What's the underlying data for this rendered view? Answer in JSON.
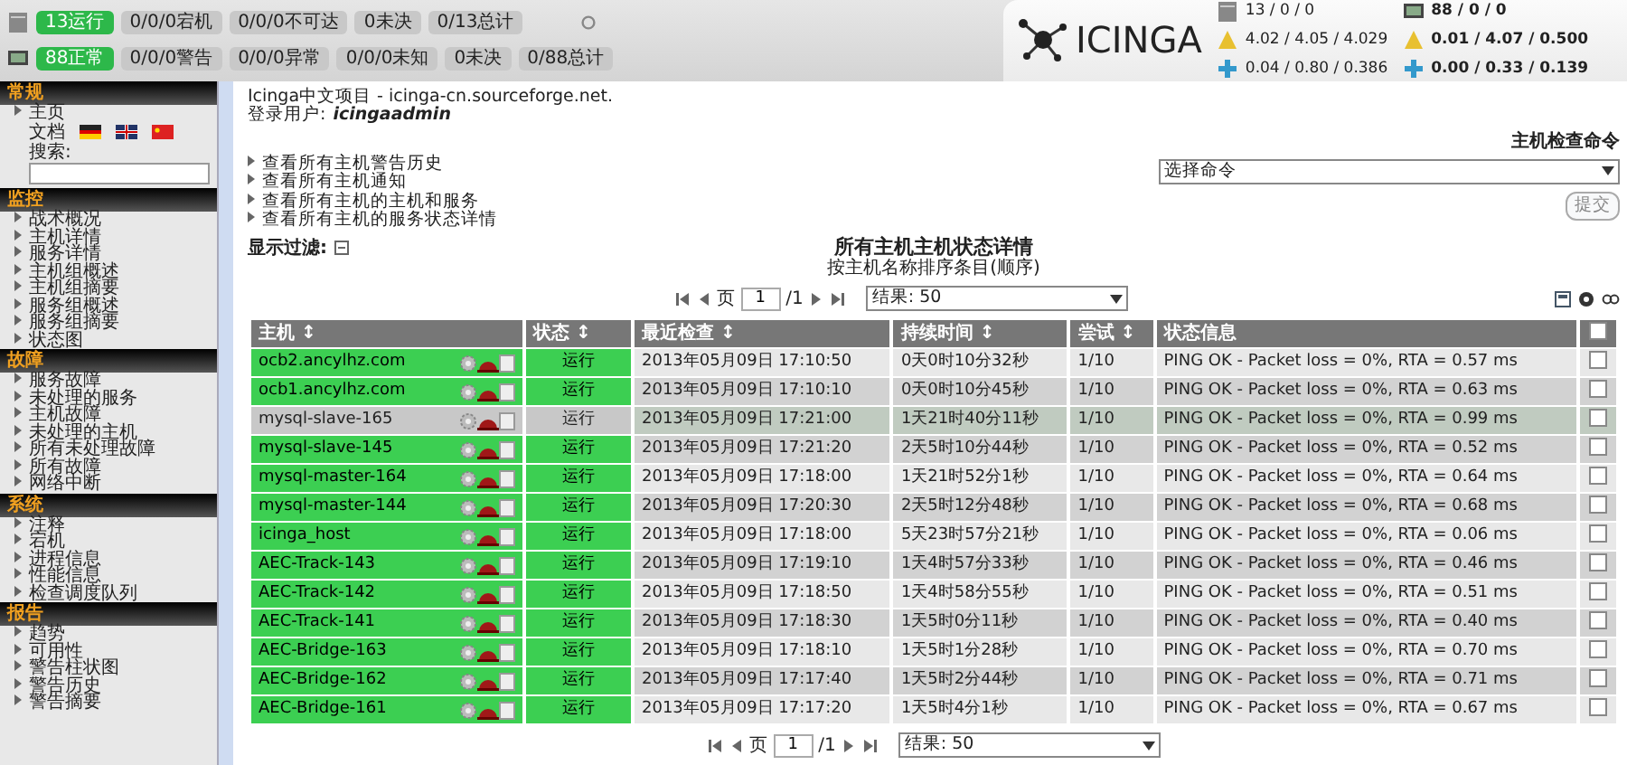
{
  "host_summary": {
    "items": [
      {
        "text": "13运行",
        "kind": "ok"
      },
      {
        "text": "0/0/0宕机",
        "kind": "plain"
      },
      {
        "text": "0/0/0不可达",
        "kind": "plain"
      },
      {
        "text": "0未决",
        "kind": "plain"
      },
      {
        "text": "0/13总计",
        "kind": "plain"
      }
    ]
  },
  "service_summary": {
    "items": [
      {
        "text": "88正常",
        "kind": "ok"
      },
      {
        "text": "0/0/0警告",
        "kind": "plain"
      },
      {
        "text": "0/0/0异常",
        "kind": "plain"
      },
      {
        "text": "0/0/0未知",
        "kind": "plain"
      },
      {
        "text": "0未决",
        "kind": "plain"
      },
      {
        "text": "0/88总计",
        "kind": "plain"
      }
    ]
  },
  "logo": {
    "text": "ICINGA"
  },
  "stats": {
    "hosts": [
      "13 / 0 / 0",
      "4.02 / 4.05 / 4.029",
      "0.04 / 0.80 / 0.386"
    ],
    "services": [
      "88 / 0 / 0",
      "0.01 / 4.07 / 0.500",
      "0.00 / 0.33 / 0.139"
    ]
  },
  "sidebar": {
    "sections": [
      {
        "title": "常规",
        "items": [
          "主页"
        ],
        "docs_label": "文档",
        "search_label": "搜索:"
      },
      {
        "title": "监控",
        "items": [
          "战术概况",
          "主机详情",
          "服务详情",
          "主机组概述",
          "主机组摘要",
          "服务组概述",
          "服务组摘要",
          "状态图"
        ]
      },
      {
        "title": "故障",
        "items": [
          "服务故障",
          "未处理的服务",
          "主机故障",
          "未处理的主机",
          "所有未处理故障",
          "所有故障",
          "网络中断"
        ]
      },
      {
        "title": "系统",
        "items": [
          "注释",
          "宕机",
          "进程信息",
          "性能信息",
          "检查调度队列"
        ]
      },
      {
        "title": "报告",
        "items": [
          "趋势",
          "可用性",
          "警告柱状图",
          "警告历史",
          "警告摘要"
        ]
      }
    ]
  },
  "header": {
    "project": "Icinga中文项目 - icinga-cn.sourceforge.net.",
    "user_label": "登录用户:",
    "user": "icingaadmin"
  },
  "links": [
    "查看所有主机警告历史",
    "查看所有主机通知",
    "查看所有主机的主机和服务",
    "查看所有主机的服务状态详情"
  ],
  "command": {
    "title": "主机检查命令",
    "select": "选择命令",
    "submit": "提交"
  },
  "filter_label": "显示过滤:",
  "title": "所有主机主机状态详情",
  "subtitle": "按主机名称排序条目(顺序)",
  "pager": {
    "page_label": "页",
    "page": "1",
    "total": "/1",
    "results": "结果: 50"
  },
  "pager_bottom": {
    "page_label": "页",
    "page": "1",
    "total": "/1",
    "results": "结果: 50"
  },
  "table": {
    "select_all_checked": false,
    "columns": [
      "主机 ↕",
      "状态 ↕",
      "最近检查 ↕",
      "持续时间 ↕",
      "尝试 ↕",
      "状态信息"
    ],
    "rows": [
      {
        "host": "ocb2.ancylhz.com",
        "status": "运行",
        "last_check": "2013年05月09日 17:10:50",
        "duration": "0天0时10分32秒",
        "attempt": "1/10",
        "info": "PING OK - Packet loss = 0%, RTA = 0.57 ms",
        "highlighted": false,
        "checked": false
      },
      {
        "host": "ocb1.ancylhz.com",
        "status": "运行",
        "last_check": "2013年05月09日 17:10:10",
        "duration": "0天0时10分45秒",
        "attempt": "1/10",
        "info": "PING OK - Packet loss = 0%, RTA = 0.63 ms",
        "highlighted": false,
        "checked": false
      },
      {
        "host": "mysql-slave-165",
        "status": "运行",
        "last_check": "2013年05月09日 17:21:00",
        "duration": "1天21时40分11秒",
        "attempt": "1/10",
        "info": "PING OK - Packet loss = 0%, RTA = 0.99 ms",
        "highlighted": true,
        "checked": false
      },
      {
        "host": "mysql-slave-145",
        "status": "运行",
        "last_check": "2013年05月09日 17:21:20",
        "duration": "2天5时10分44秒",
        "attempt": "1/10",
        "info": "PING OK - Packet loss = 0%, RTA = 0.52 ms",
        "highlighted": false,
        "checked": false
      },
      {
        "host": "mysql-master-164",
        "status": "运行",
        "last_check": "2013年05月09日 17:18:00",
        "duration": "1天21时52分1秒",
        "attempt": "1/10",
        "info": "PING OK - Packet loss = 0%, RTA = 0.64 ms",
        "highlighted": false,
        "checked": false
      },
      {
        "host": "mysql-master-144",
        "status": "运行",
        "last_check": "2013年05月09日 17:20:30",
        "duration": "2天5时12分48秒",
        "attempt": "1/10",
        "info": "PING OK - Packet loss = 0%, RTA = 0.68 ms",
        "highlighted": false,
        "checked": false
      },
      {
        "host": "icinga_host",
        "status": "运行",
        "last_check": "2013年05月09日 17:18:00",
        "duration": "5天23时57分21秒",
        "attempt": "1/10",
        "info": "PING OK - Packet loss = 0%, RTA = 0.06 ms",
        "highlighted": false,
        "checked": false
      },
      {
        "host": "AEC-Track-143",
        "status": "运行",
        "last_check": "2013年05月09日 17:19:10",
        "duration": "1天4时57分33秒",
        "attempt": "1/10",
        "info": "PING OK - Packet loss = 0%, RTA = 0.46 ms",
        "highlighted": false,
        "checked": false
      },
      {
        "host": "AEC-Track-142",
        "status": "运行",
        "last_check": "2013年05月09日 17:18:50",
        "duration": "1天4时58分55秒",
        "attempt": "1/10",
        "info": "PING OK - Packet loss = 0%, RTA = 0.51 ms",
        "highlighted": false,
        "checked": false
      },
      {
        "host": "AEC-Track-141",
        "status": "运行",
        "last_check": "2013年05月09日 17:18:30",
        "duration": "1天5时0分11秒",
        "attempt": "1/10",
        "info": "PING OK - Packet loss = 0%, RTA = 0.40 ms",
        "highlighted": false,
        "checked": false
      },
      {
        "host": "AEC-Bridge-163",
        "status": "运行",
        "last_check": "2013年05月09日 17:18:10",
        "duration": "1天5时1分28秒",
        "attempt": "1/10",
        "info": "PING OK - Packet loss = 0%, RTA = 0.70 ms",
        "highlighted": false,
        "checked": false
      },
      {
        "host": "AEC-Bridge-162",
        "status": "运行",
        "last_check": "2013年05月09日 17:17:40",
        "duration": "1天5时2分44秒",
        "attempt": "1/10",
        "info": "PING OK - Packet loss = 0%, RTA = 0.71 ms",
        "highlighted": false,
        "checked": false
      },
      {
        "host": "AEC-Bridge-161",
        "status": "运行",
        "last_check": "2013年05月09日 17:17:20",
        "duration": "1天5时4分1秒",
        "attempt": "1/10",
        "info": "PING OK - Packet loss = 0%, RTA = 0.67 ms",
        "highlighted": false,
        "checked": false
      }
    ]
  }
}
